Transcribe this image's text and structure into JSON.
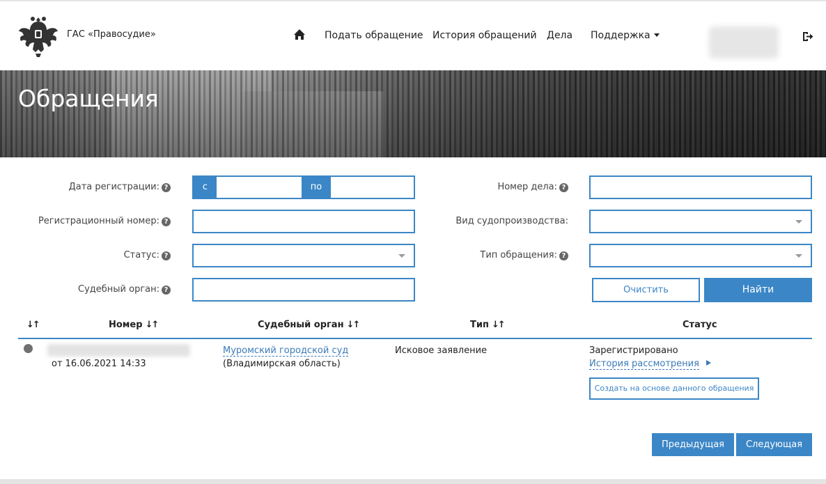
{
  "header": {
    "brand": "ГАС «Правосудие»",
    "logo_icon": "coat-of-arms-emblem",
    "home_icon": "home-icon",
    "nav": [
      {
        "label": "Подать обращение"
      },
      {
        "label": "История обращений"
      },
      {
        "label": "Дела"
      },
      {
        "label": "Поддержка"
      }
    ],
    "logout_icon": "logout-icon"
  },
  "banner": {
    "title": "Обращения"
  },
  "filters": {
    "date_label": "Дата регистрации:",
    "date_from_addon": "с",
    "date_to_addon": "по",
    "date_from_value": "",
    "date_to_value": "",
    "reg_number_label": "Регистрационный номер:",
    "reg_number_value": "",
    "status_label": "Статус:",
    "status_value": "",
    "court_label": "Судебный орган:",
    "court_value": "",
    "case_number_label": "Номер дела:",
    "case_number_value": "",
    "proceeding_label": "Вид судопроизводства:",
    "proceeding_value": "",
    "appeal_type_label": "Тип обращения:",
    "appeal_type_value": "",
    "clear_button": "Очистить",
    "find_button": "Найти"
  },
  "table": {
    "columns": {
      "sort_all": "",
      "number": "Номер",
      "court": "Судебный орган",
      "type": "Тип",
      "status": "Статус"
    },
    "rows": [
      {
        "date": "от 16.06.2021 14:33",
        "court_name": "Муромский городской суд",
        "court_region": "(Владимирская область)",
        "type": "Исковое заявление",
        "status": "Зарегистрировано",
        "history_link": "История рассмотрения",
        "create_button": "Создать на основе данного обращения"
      }
    ]
  },
  "pagination": {
    "prev": "Предыдущая",
    "next": "Следующая"
  },
  "colors": {
    "accent": "#3b86c6",
    "link": "#3b7ab8"
  }
}
